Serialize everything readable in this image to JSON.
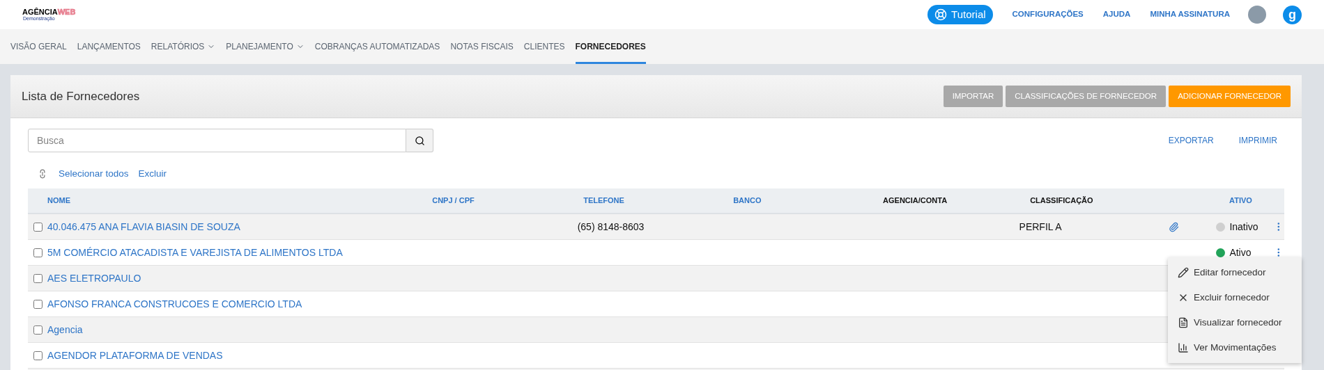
{
  "header": {
    "logo": {
      "main": "AGÊNCIA",
      "accent": "WEB",
      "subtitle": "Demonstração"
    },
    "tutorial_button": "Tutorial",
    "links": [
      "CONFIGURAÇÕES",
      "AJUDA",
      "MINHA ASSINATURA"
    ],
    "brand_mark": "g"
  },
  "nav": [
    {
      "label": "VISÃO GERAL",
      "selected": false,
      "dropdown": false
    },
    {
      "label": "LANÇAMENTOS",
      "selected": false,
      "dropdown": false
    },
    {
      "label": "RELATÓRIOS",
      "selected": false,
      "dropdown": true
    },
    {
      "label": "PLANEJAMENTO",
      "selected": false,
      "dropdown": true
    },
    {
      "label": "COBRANÇAS AUTOMATIZADAS",
      "selected": false,
      "dropdown": false
    },
    {
      "label": "NOTAS FISCAIS",
      "selected": false,
      "dropdown": false
    },
    {
      "label": "CLIENTES",
      "selected": false,
      "dropdown": false
    },
    {
      "label": "FORNECEDORES",
      "selected": true,
      "dropdown": false
    }
  ],
  "panel": {
    "title": "Lista de Fornecedores",
    "buttons": [
      {
        "label": "IMPORTAR",
        "kind": "secondary"
      },
      {
        "label": "CLASSIFICAÇÕES DE FORNECEDOR",
        "kind": "secondary"
      },
      {
        "label": "ADICIONAR FORNECEDOR",
        "kind": "primary"
      }
    ],
    "search": {
      "placeholder": "Busca"
    },
    "export_links": [
      "EXPORTAR",
      "IMPRIMIR"
    ],
    "bulk_actions": [
      "Selecionar todos",
      "Excluir"
    ]
  },
  "table": {
    "columns": [
      {
        "label": "NOME",
        "sortable": true
      },
      {
        "label": "CNPJ / CPF",
        "sortable": true
      },
      {
        "label": "TELEFONE",
        "sortable": true
      },
      {
        "label": "BANCO",
        "sortable": true
      },
      {
        "label": "AGENCIA/CONTA",
        "sortable": false
      },
      {
        "label": "CLASSIFICAÇÃO",
        "sortable": false
      },
      {
        "label": "ATIVO",
        "sortable": true
      }
    ],
    "rows": [
      {
        "name": "40.046.475 ANA FLAVIA BIASIN DE SOUZA",
        "checked": false,
        "phone": "(65) 8148-8603",
        "classification": "PERFIL A",
        "attachment": true,
        "status": {
          "label": "Inativo",
          "active": false
        }
      },
      {
        "name": "5M COMÉRCIO ATACADISTA E VAREJISTA DE ALIMENTOS LTDA",
        "checked": false,
        "attachment": false,
        "status": {
          "label": "Ativo",
          "active": true
        }
      },
      {
        "name": "AES ELETROPAULO",
        "checked": false,
        "attachment": false
      },
      {
        "name": "AFONSO FRANCA CONSTRUCOES E COMERCIO LTDA",
        "checked": false,
        "attachment": false
      },
      {
        "name": "Agencia",
        "checked": false,
        "attachment": false
      },
      {
        "name": "AGENDOR PLATAFORMA DE VENDAS",
        "checked": false,
        "attachment": false
      }
    ]
  },
  "row_menu": [
    {
      "label": "Editar fornecedor",
      "kind": "edit"
    },
    {
      "label": "Excluir fornecedor",
      "kind": "delete"
    },
    {
      "label": "Visualizar fornecedor",
      "kind": "view"
    },
    {
      "label": "Ver Movimentações",
      "kind": "chart"
    }
  ]
}
